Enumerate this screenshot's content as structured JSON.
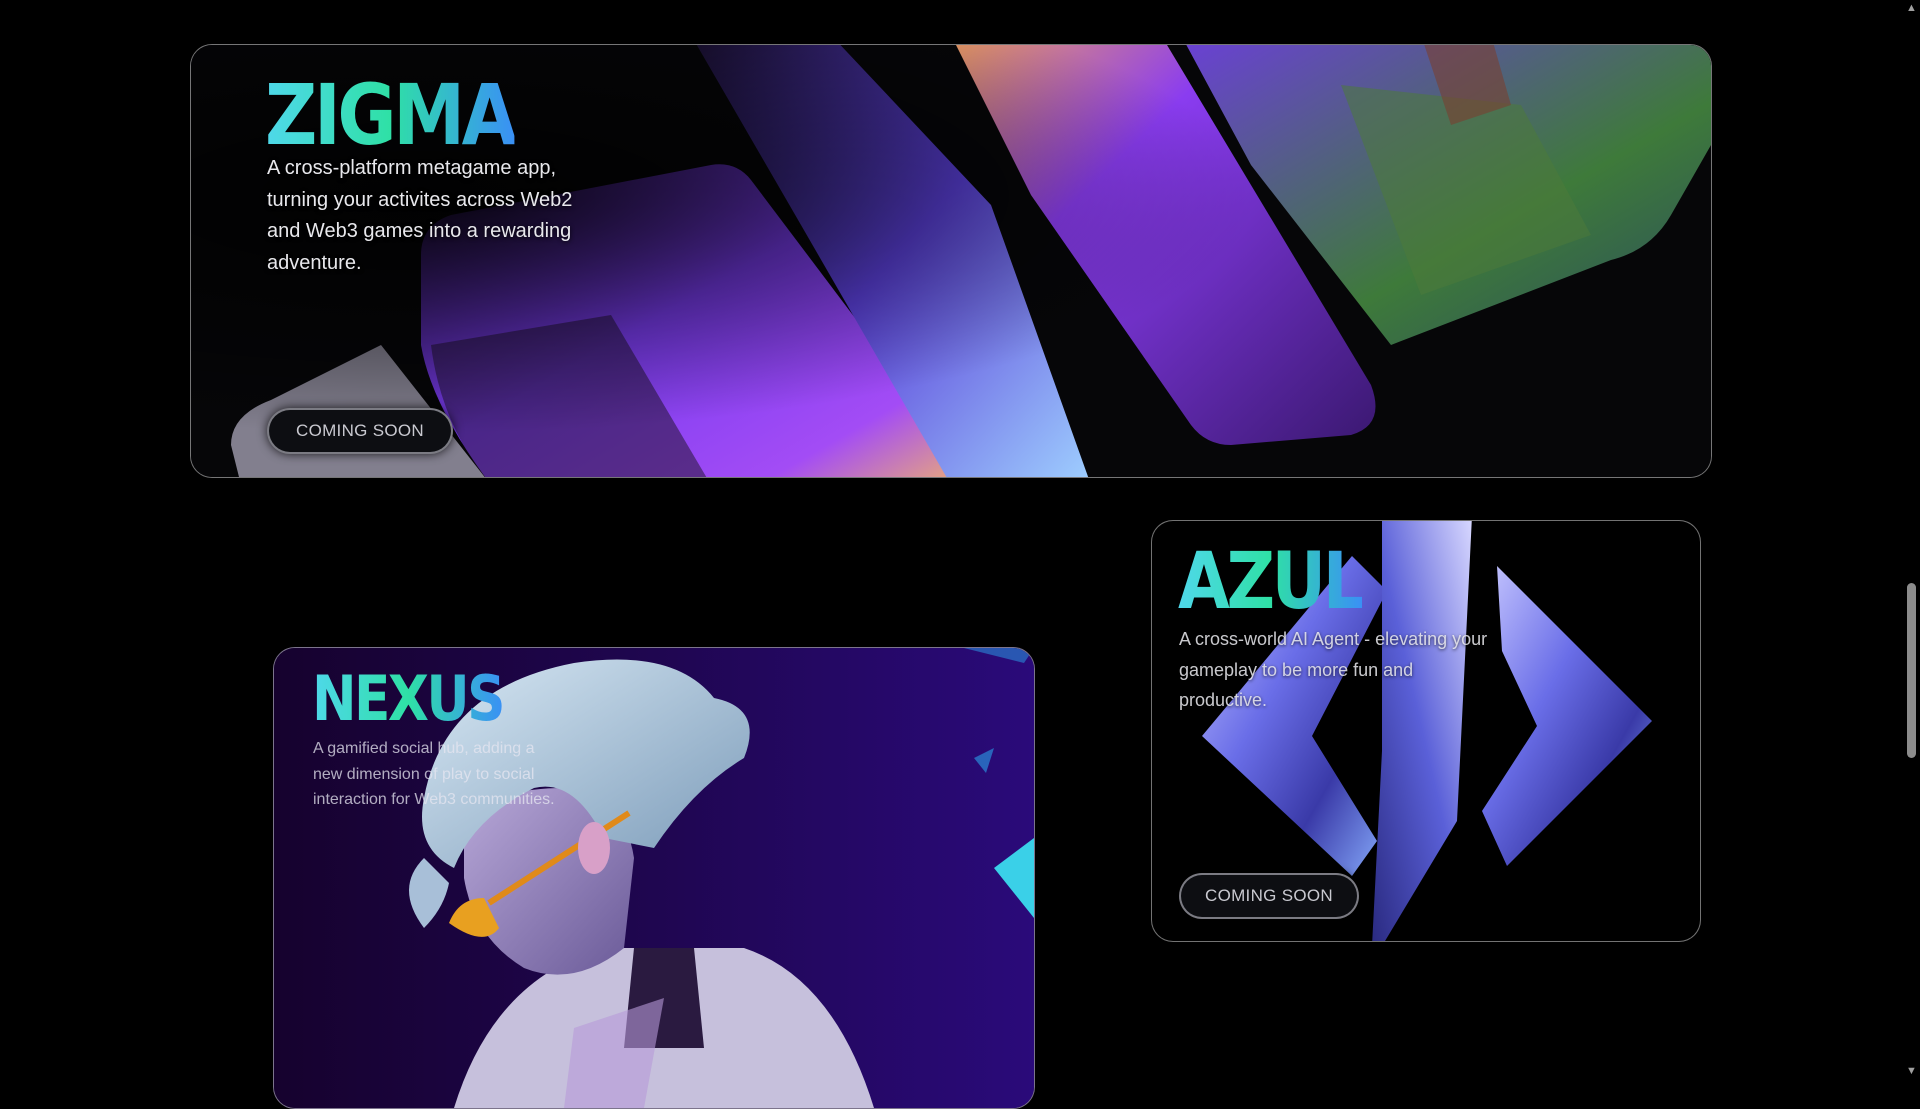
{
  "theme": {
    "page_bg": "#000000",
    "logo_gradient": [
      "#4fd8ea",
      "#2fe0a6",
      "#3a90f5"
    ],
    "accent_purple": "#7a3cf0",
    "accent_orange": "#f2b56a",
    "card_border": "#8a8a92"
  },
  "projects": {
    "zigma": {
      "title": "ZIGMA",
      "description": "A cross-platform metagame app, turning your activites across Web2 and Web3 games into a rewarding adventure.",
      "button_label": "COMING SOON",
      "art_icon": "game-screens-collage"
    },
    "azul": {
      "title": "AZUL",
      "description": "A cross-world AI Agent - elevating your gameplay to be more fun and productive.",
      "button_label": "COMING SOON",
      "art_icon": "chrome-diamond-logo"
    },
    "nexus": {
      "title": "NEXUS",
      "description": "A gamified social hub, adding a new dimension of play to social interaction for Web3 communities.",
      "art_icon": "anime-character-with-sunglasses"
    }
  },
  "scrollbar": {
    "up_icon": "triangle-up-icon",
    "down_icon": "triangle-down-icon"
  }
}
